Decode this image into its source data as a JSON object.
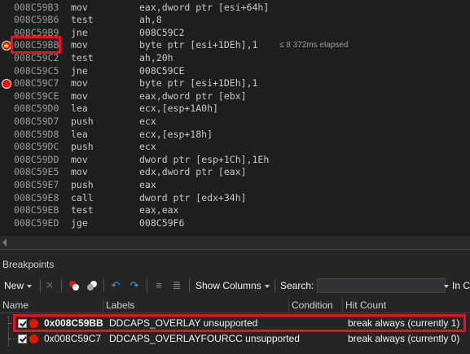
{
  "disassembly": {
    "rows": [
      {
        "addr": "008C59B3",
        "mnem": "mov",
        "ops": "eax,dword ptr [esi+64h]",
        "bp": ""
      },
      {
        "addr": "008C59B6",
        "mnem": "test",
        "ops": "ah,8",
        "bp": ""
      },
      {
        "addr": "008C59B9",
        "mnem": "jne",
        "ops": "008C59C2",
        "bp": ""
      },
      {
        "addr": "008C59BB",
        "mnem": "mov",
        "ops": "byte ptr [esi+1DEh],1",
        "bp": "current"
      },
      {
        "addr": "008C59C2",
        "mnem": "test",
        "ops": "ah,20h",
        "bp": ""
      },
      {
        "addr": "008C59C5",
        "mnem": "jne",
        "ops": "008C59CE",
        "bp": ""
      },
      {
        "addr": "008C59C7",
        "mnem": "mov",
        "ops": "byte ptr [esi+1DEh],1",
        "bp": "breakpoint"
      },
      {
        "addr": "008C59CE",
        "mnem": "mov",
        "ops": "eax,dword ptr [ebx]",
        "bp": ""
      },
      {
        "addr": "008C59D0",
        "mnem": "lea",
        "ops": "ecx,[esp+1A0h]",
        "bp": ""
      },
      {
        "addr": "008C59D7",
        "mnem": "push",
        "ops": "ecx",
        "bp": ""
      },
      {
        "addr": "008C59D8",
        "mnem": "lea",
        "ops": "ecx,[esp+18h]",
        "bp": ""
      },
      {
        "addr": "008C59DC",
        "mnem": "push",
        "ops": "ecx",
        "bp": ""
      },
      {
        "addr": "008C59DD",
        "mnem": "mov",
        "ops": "dword ptr [esp+1Ch],1Eh",
        "bp": ""
      },
      {
        "addr": "008C59E5",
        "mnem": "mov",
        "ops": "edx,dword ptr [eax]",
        "bp": ""
      },
      {
        "addr": "008C59E7",
        "mnem": "push",
        "ops": "eax",
        "bp": ""
      },
      {
        "addr": "008C59E8",
        "mnem": "call",
        "ops": "dword ptr [edx+34h]",
        "bp": ""
      },
      {
        "addr": "008C59EB",
        "mnem": "test",
        "ops": "eax,eax",
        "bp": ""
      },
      {
        "addr": "008C59ED",
        "mnem": "jge",
        "ops": "008C59F6",
        "bp": ""
      }
    ],
    "perf_tip": "≤ 8 372ms elapsed"
  },
  "breakpoints_window": {
    "title": "Breakpoints",
    "toolbar": {
      "new_label": "New",
      "show_columns_label": "Show Columns",
      "search_label": "Search:",
      "search_value": "",
      "in_label": "In C"
    },
    "columns": [
      "Name",
      "Labels",
      "Condition",
      "Hit Count"
    ],
    "rows": [
      {
        "name": "0x008C59BB",
        "labels": "DDCAPS_OVERLAY unsupported",
        "condition": "",
        "hit_count": "break always (currently 1)",
        "checked": true,
        "current": true
      },
      {
        "name": "0x008C59C7",
        "labels": "DDCAPS_OVERLAYFOURCC unsupported",
        "condition": "",
        "hit_count": "break always (currently 0)",
        "checked": true,
        "current": false
      }
    ]
  },
  "colors": {
    "background": "#1e1e1e",
    "breakpoint": "#e51400",
    "highlight": "#e81123",
    "current_arrow": "#ffcc00"
  },
  "icons": [
    "breakpoint-current-icon",
    "breakpoint-icon",
    "delete-icon",
    "disable-all-icon",
    "go-to-source-icon",
    "undo-icon",
    "redo-icon",
    "export-icon",
    "import-icon",
    "checkbox-icon"
  ]
}
